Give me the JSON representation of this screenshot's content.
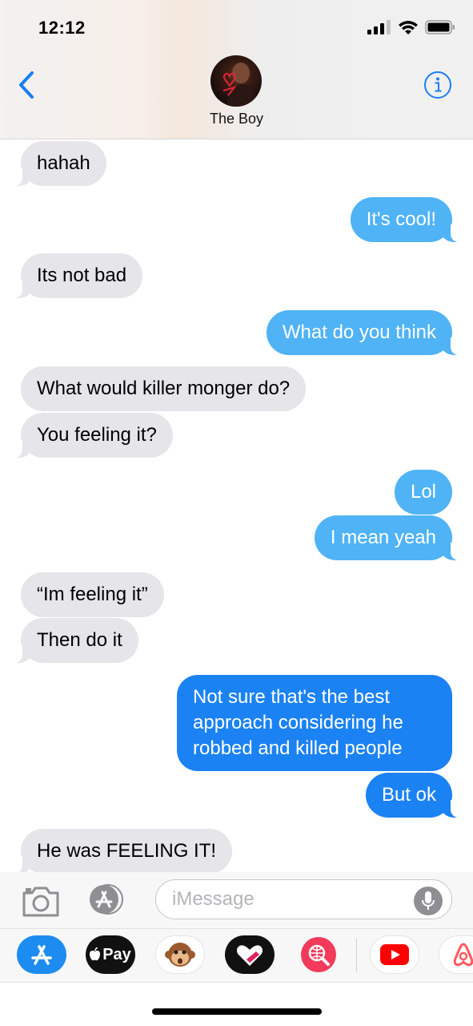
{
  "status_bar": {
    "time": "12:12"
  },
  "header": {
    "contact_name": "The Boy"
  },
  "messages": [
    {
      "text": "hahah",
      "direction": "incoming"
    },
    {
      "text": "It's cool!",
      "direction": "outgoing"
    },
    {
      "text": "Its not bad",
      "direction": "incoming"
    },
    {
      "text": "What do you think",
      "direction": "outgoing"
    },
    {
      "text": "What would killer monger do?",
      "direction": "incoming"
    },
    {
      "text": "You feeling it?",
      "direction": "incoming"
    },
    {
      "text": "Lol",
      "direction": "outgoing"
    },
    {
      "text": "I mean yeah",
      "direction": "outgoing"
    },
    {
      "text": "“Im feeling it”",
      "direction": "incoming"
    },
    {
      "text": "Then do it",
      "direction": "incoming"
    },
    {
      "text": "Not sure that's the best approach considering he robbed and killed people",
      "direction": "outgoing"
    },
    {
      "text": "But ok",
      "direction": "outgoing"
    },
    {
      "text": "He was FEELING IT!",
      "direction": "incoming"
    }
  ],
  "input": {
    "placeholder": "iMessage"
  },
  "app_drawer": {
    "apple_pay_label": "Pay",
    "icons": [
      "app-store-icon",
      "apple-pay-icon",
      "animoji-monkey-icon",
      "digital-touch-icon",
      "web-images-search-icon",
      "youtube-icon",
      "airbnb-icon"
    ]
  },
  "colors": {
    "incoming_bubble": "#e5e5ea",
    "outgoing_bubble_light": "#4fb3f5",
    "outgoing_bubble_dark": "#1b82f3",
    "ios_blue": "#1a7ef2"
  }
}
